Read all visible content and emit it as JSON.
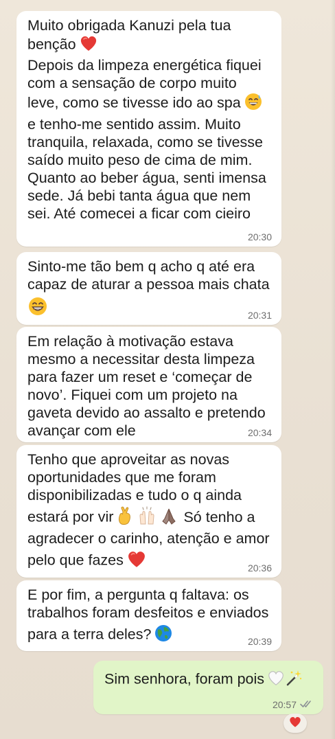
{
  "messages": [
    {
      "direction": "incoming",
      "lines": [
        "Muito obrigada Kanuzi pela tua",
        "benção",
        "Depois da limpeza energética fiquei",
        "com a sensação de corpo muito",
        "leve, como se tivesse ido ao spa",
        "e tenho-me sentido assim. Muito",
        "tranquila, relaxada, como se tivesse",
        "saído muito peso de cima de mim.",
        "Quanto ao beber água, senti imensa",
        "sede. Já bebi tanta água que nem",
        "sei. Até comecei a ficar com cieiro"
      ],
      "emoji": [
        "red-heart",
        "grinning-sweat-face"
      ],
      "time": "20:30"
    },
    {
      "direction": "incoming",
      "lines": [
        "Sinto-me tão bem q acho q até era",
        "capaz de aturar a pessoa mais chata"
      ],
      "emoji": [
        "beaming-face"
      ],
      "time": "20:31"
    },
    {
      "direction": "incoming",
      "lines": [
        "Em relação à motivação estava",
        "mesmo a necessitar desta limpeza",
        "para fazer um reset e ‘começar de",
        "novo’. Fiquei com um projeto na",
        "gaveta devido ao assalto e pretendo",
        "avançar com ele"
      ],
      "time": "20:34"
    },
    {
      "direction": "incoming",
      "lines": [
        "Tenho que aproveitar as novas",
        "oportunidades que me foram",
        "disponibilizadas e tudo o q ainda",
        "estará por vir",
        "Só tenho a",
        "agradecer o carinho, atenção e amor",
        "pelo que fazes"
      ],
      "emoji": [
        "crossed-fingers",
        "raising-hands",
        "folded-hands",
        "red-heart"
      ],
      "time": "20:36"
    },
    {
      "direction": "incoming",
      "lines": [
        "E por fim, a pergunta q faltava: os",
        "trabalhos foram desfeitos e enviados",
        "para a terra deles?"
      ],
      "emoji": [
        "globe"
      ],
      "time": "20:39"
    },
    {
      "direction": "outgoing",
      "lines": [
        "Sim senhora, foram pois"
      ],
      "emoji": [
        "white-heart",
        "magic-wand"
      ],
      "time": "20:57",
      "status_icon": "double-check-icon",
      "reaction": "red-heart"
    }
  ],
  "colors": {
    "background": "#ece4d8",
    "incoming_bubble": "#ffffff",
    "outgoing_bubble": "#e1f5c8",
    "text": "#1c1c1c",
    "timestamp": "#6d6d6d",
    "heart": "#e53935"
  }
}
